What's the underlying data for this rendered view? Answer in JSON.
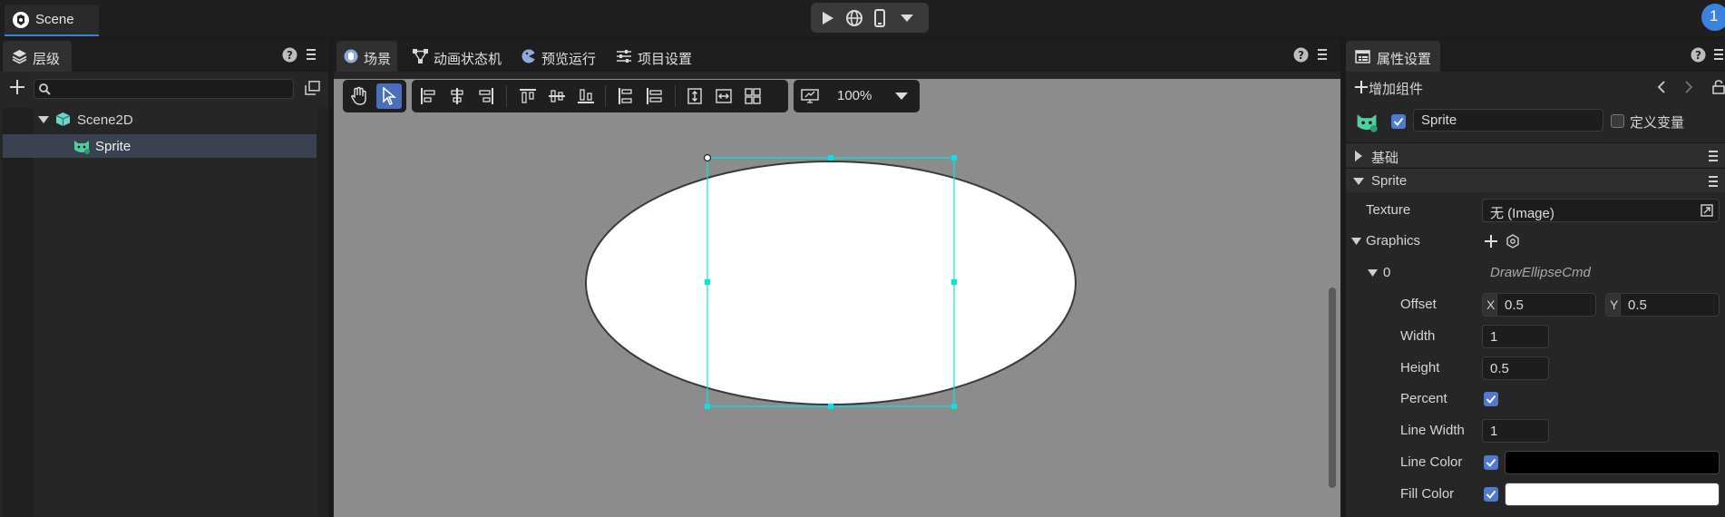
{
  "window": {
    "scene_tab": "Scene",
    "badge": "1"
  },
  "hierarchy": {
    "tab": "层级",
    "search_placeholder": "",
    "nodes": [
      {
        "label": "Scene2D",
        "icon": "cube-icon"
      },
      {
        "label": "Sprite",
        "icon": "sprite-icon"
      }
    ]
  },
  "center": {
    "tabs": [
      "场景",
      "动画状态机",
      "预览运行",
      "项目设置"
    ],
    "zoom": "100%"
  },
  "inspector": {
    "tab": "属性设置",
    "add_component": "增加组件",
    "node_name": "Sprite",
    "define_var": "定义变量",
    "sections": {
      "basic": "基础",
      "sprite": "Sprite"
    },
    "texture_label": "Texture",
    "texture_value": "无 (Image)",
    "graphics_label": "Graphics",
    "cmd_index": "0",
    "cmd_name": "DrawEllipseCmd",
    "offset_label": "Offset",
    "offset_x_axis": "X",
    "offset_x": "0.5",
    "offset_y_axis": "Y",
    "offset_y": "0.5",
    "width_label": "Width",
    "width_value": "1",
    "height_label": "Height",
    "height_value": "0.5",
    "percent_label": "Percent",
    "percent_checked": true,
    "line_width_label": "Line Width",
    "line_width_value": "1",
    "line_color_label": "Line Color",
    "line_color": "#000000",
    "fill_color_label": "Fill Color",
    "fill_color": "#ffffff"
  },
  "colors": {
    "accent": "#3d7fd6",
    "selection": "#00e5e5",
    "active_tool": "#4a6fb8"
  }
}
